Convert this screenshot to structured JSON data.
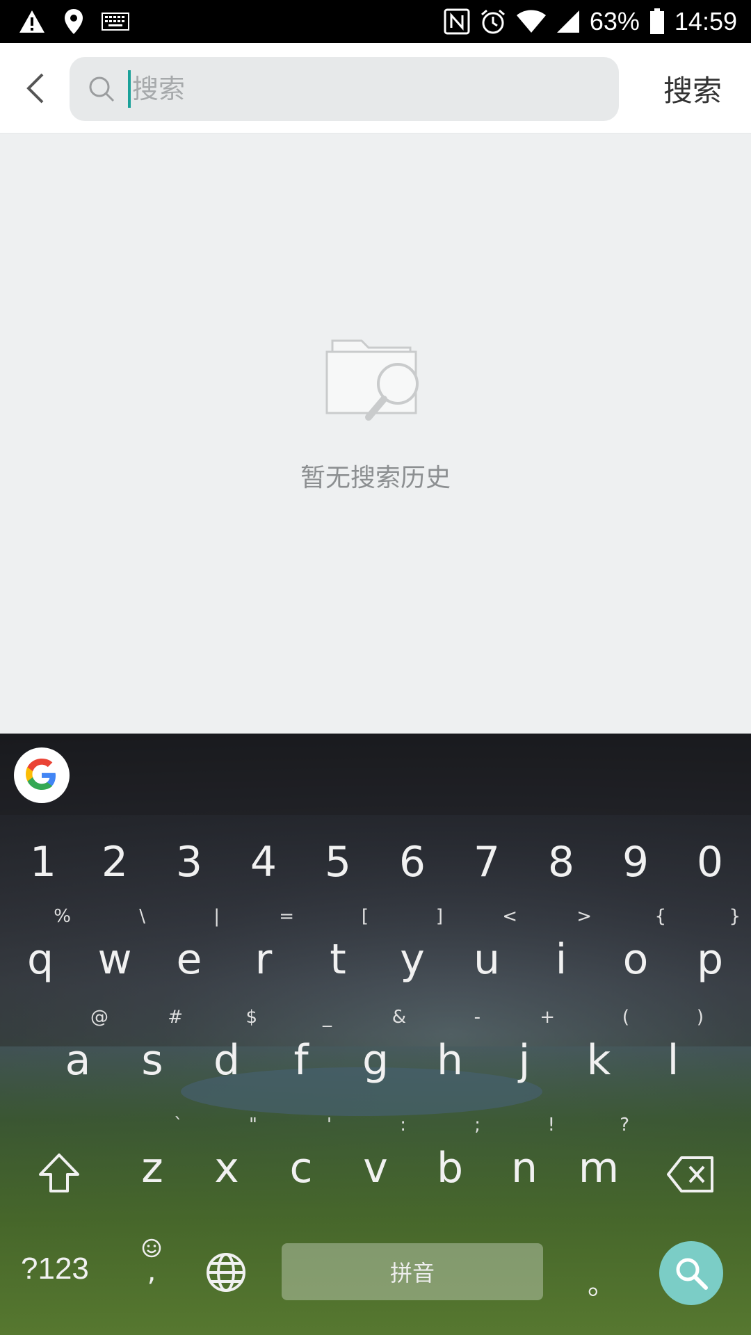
{
  "status_bar": {
    "battery": "63%",
    "time": "14:59",
    "icons": [
      "warning-icon",
      "location-icon",
      "keyboard-icon",
      "nfc-icon",
      "alarm-icon",
      "wifi-icon",
      "signal-icon",
      "battery-icon"
    ]
  },
  "header": {
    "search_placeholder": "搜索",
    "search_button_label": "搜索"
  },
  "empty_state": {
    "message": "暂无搜索历史"
  },
  "keyboard": {
    "number_row": [
      "1",
      "2",
      "3",
      "4",
      "5",
      "6",
      "7",
      "8",
      "9",
      "0"
    ],
    "row1": [
      {
        "key": "q",
        "hint": "%"
      },
      {
        "key": "w",
        "hint": "\\"
      },
      {
        "key": "e",
        "hint": "|"
      },
      {
        "key": "r",
        "hint": "="
      },
      {
        "key": "t",
        "hint": "["
      },
      {
        "key": "y",
        "hint": "]"
      },
      {
        "key": "u",
        "hint": "<"
      },
      {
        "key": "i",
        "hint": ">"
      },
      {
        "key": "o",
        "hint": "{"
      },
      {
        "key": "p",
        "hint": "}"
      }
    ],
    "row2": [
      {
        "key": "a",
        "hint": "@"
      },
      {
        "key": "s",
        "hint": "#"
      },
      {
        "key": "d",
        "hint": "$"
      },
      {
        "key": "f",
        "hint": "_"
      },
      {
        "key": "g",
        "hint": "&"
      },
      {
        "key": "h",
        "hint": "-"
      },
      {
        "key": "j",
        "hint": "+"
      },
      {
        "key": "k",
        "hint": "("
      },
      {
        "key": "l",
        "hint": ")"
      }
    ],
    "row3": [
      {
        "key": "z",
        "hint": "`"
      },
      {
        "key": "x",
        "hint": "\""
      },
      {
        "key": "c",
        "hint": "'"
      },
      {
        "key": "v",
        "hint": ":"
      },
      {
        "key": "b",
        "hint": ";"
      },
      {
        "key": "n",
        "hint": "!"
      },
      {
        "key": "m",
        "hint": "?"
      }
    ],
    "symbols_label": "?123",
    "comma_label": ",",
    "space_label": "拼音",
    "period_label": "。"
  }
}
